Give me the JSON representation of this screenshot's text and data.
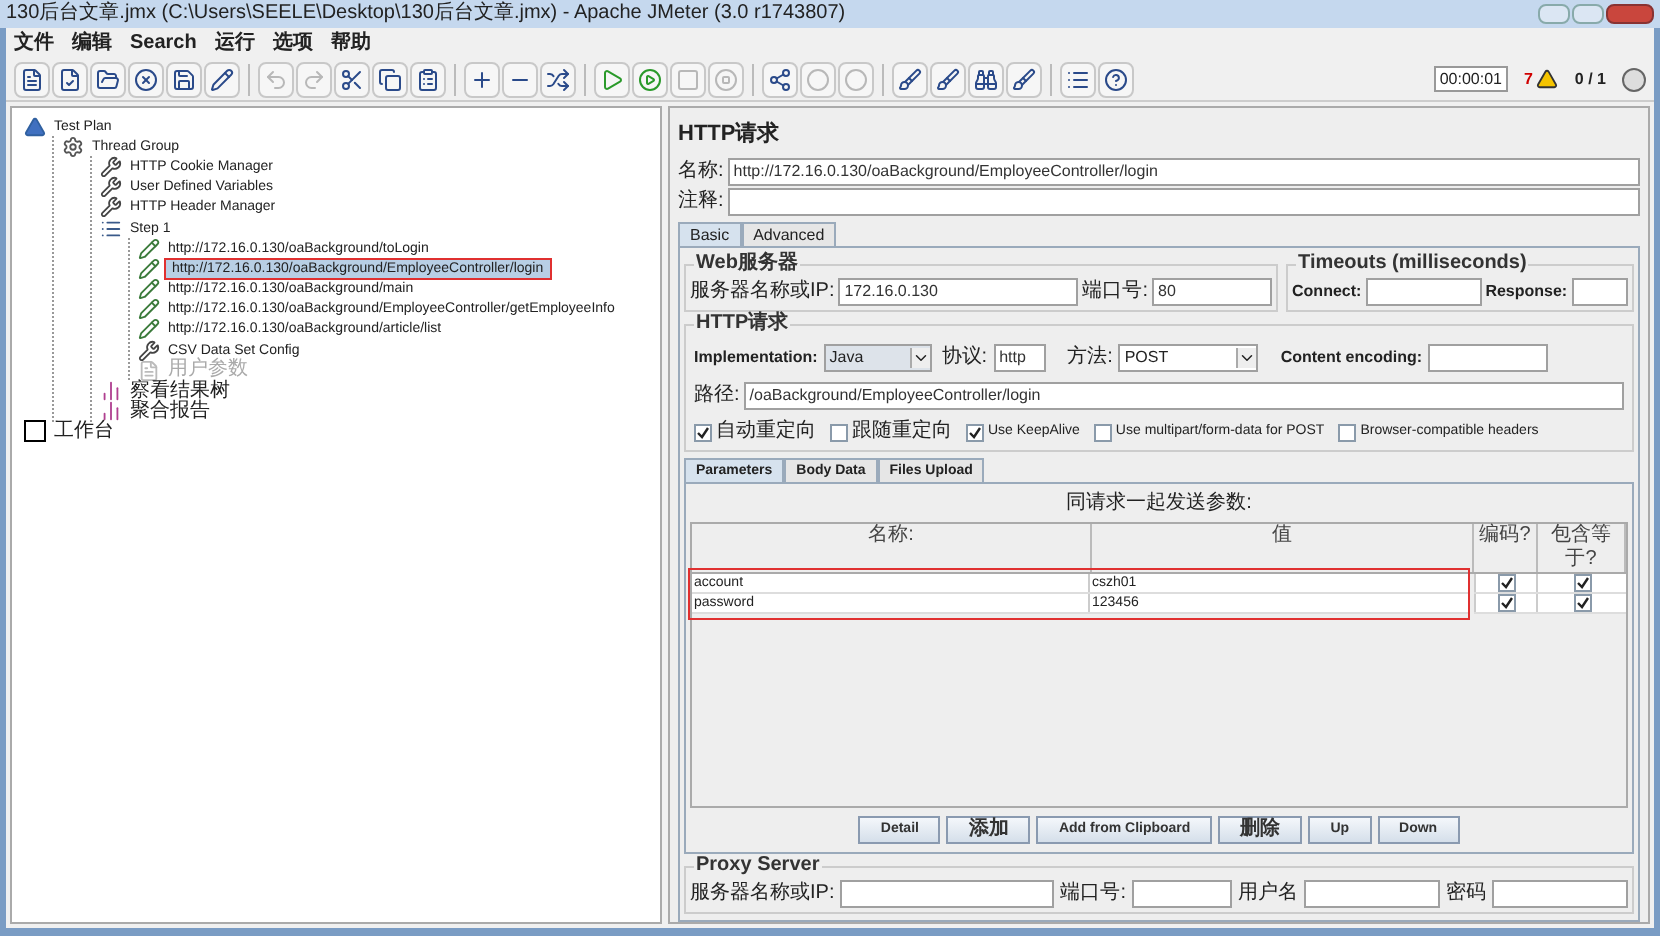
{
  "window": {
    "title": "130后台文章.jmx (C:\\Users\\SEELE\\Desktop\\130后台文章.jmx) - Apache JMeter (3.0 r1743807)"
  },
  "menu": [
    "文件",
    "编辑",
    "Search",
    "运行",
    "选项",
    "帮助"
  ],
  "toolbar": [
    {
      "disabled": false
    },
    {
      "disabled": false
    },
    {
      "disabled": false
    },
    {
      "disabled": false
    },
    {
      "disabled": false
    },
    {
      "disabled": false
    },
    {
      "disabled": true
    },
    {
      "disabled": true
    },
    {
      "disabled": false
    },
    {
      "disabled": false
    },
    {
      "disabled": false
    },
    {
      "disabled": false
    },
    {
      "disabled": false
    },
    {
      "disabled": false
    },
    {
      "disabled": false
    },
    {
      "disabled": false
    },
    {
      "disabled": true
    },
    {
      "disabled": true
    },
    {
      "disabled": false
    },
    {
      "disabled": true
    },
    {
      "disabled": true
    },
    {
      "disabled": false
    },
    {
      "disabled": false
    },
    {
      "disabled": false
    },
    {
      "disabled": false
    },
    {
      "disabled": false
    },
    {
      "disabled": false
    }
  ],
  "status": {
    "timer": "00:00:01",
    "warnings": "7",
    "threads": "0 / 1"
  },
  "tree": [
    {
      "label": "Test Plan",
      "kind": "plan",
      "selected": false,
      "disabled": false,
      "children": [
        {
          "label": "Thread Group",
          "kind": "threads",
          "selected": false,
          "disabled": false,
          "children": [
            {
              "label": "HTTP Cookie Manager",
              "kind": "config",
              "selected": false,
              "disabled": false
            },
            {
              "label": "User Defined Variables",
              "kind": "config",
              "selected": false,
              "disabled": false
            },
            {
              "label": "HTTP Header Manager",
              "kind": "config",
              "selected": false,
              "disabled": false
            },
            {
              "label": "Step 1",
              "kind": "controller",
              "selected": false,
              "disabled": false,
              "children": [
                {
                  "label": "http://172.16.0.130/oaBackground/toLogin",
                  "kind": "sampler",
                  "selected": false,
                  "disabled": false
                },
                {
                  "label": "http://172.16.0.130/oaBackground/EmployeeController/login",
                  "kind": "sampler",
                  "selected": true,
                  "disabled": false
                },
                {
                  "label": "http://172.16.0.130/oaBackground/main",
                  "kind": "sampler",
                  "selected": false,
                  "disabled": false
                },
                {
                  "label": "http://172.16.0.130/oaBackground/EmployeeController/getEmployeeInfo",
                  "kind": "sampler",
                  "selected": false,
                  "disabled": false
                },
                {
                  "label": "http://172.16.0.130/oaBackground/article/list",
                  "kind": "sampler",
                  "selected": false,
                  "disabled": false
                },
                {
                  "label": "CSV Data Set Config",
                  "kind": "config",
                  "selected": false,
                  "disabled": false
                },
                {
                  "label": "用户参数",
                  "kind": "preprocessor",
                  "selected": false,
                  "disabled": true
                }
              ]
            },
            {
              "label": "察看结果树",
              "kind": "listener",
              "selected": false,
              "disabled": false
            },
            {
              "label": "聚合报告",
              "kind": "listener",
              "selected": false,
              "disabled": false
            }
          ]
        }
      ]
    },
    {
      "label": "工作台",
      "kind": "workbench",
      "selected": false,
      "disabled": false
    }
  ],
  "panel": {
    "title": "HTTP请求",
    "name_label": "名称:",
    "name": "http://172.16.0.130/oaBackground/EmployeeController/login",
    "comment_label": "注释:",
    "tabs": [
      {
        "label": "Basic",
        "selected": true
      },
      {
        "label": "Advanced",
        "selected": false
      }
    ],
    "web_server": {
      "legend": "Web服务器",
      "host_label": "服务器名称或IP:",
      "host": "172.16.0.130",
      "port_label": "端口号:",
      "port": "80"
    },
    "timeouts": {
      "legend": "Timeouts (milliseconds)",
      "connect_label": "Connect:",
      "response_label": "Response:"
    },
    "http_request": {
      "legend": "HTTP请求",
      "implementation_label": "Implementation:",
      "implementation": "Java",
      "protocol_label": "协议:",
      "protocol": "http",
      "method_label": "方法:",
      "method": "POST",
      "encoding_label": "Content encoding:",
      "path_label": "路径:",
      "path": "/oaBackground/EmployeeController/login",
      "options": [
        {
          "label": "自动重定向",
          "checked": true
        },
        {
          "label": "跟随重定向",
          "checked": false
        },
        {
          "label": "Use KeepAlive",
          "checked": true
        },
        {
          "label": "Use multipart/form-data for POST",
          "checked": false
        },
        {
          "label": "Browser-compatible headers",
          "checked": false
        }
      ]
    },
    "param_tabs": [
      {
        "label": "Parameters",
        "selected": true
      },
      {
        "label": "Body Data",
        "selected": false
      },
      {
        "label": "Files Upload",
        "selected": false
      }
    ],
    "params": {
      "caption": "同请求一起发送参数:",
      "columns": [
        "名称:",
        "值",
        "编码?",
        "包含等于?"
      ],
      "rows": [
        {
          "name": "account",
          "value": "cszh01",
          "encode": true,
          "include_equals": true
        },
        {
          "name": "password",
          "value": "123456",
          "encode": true,
          "include_equals": true
        }
      ]
    },
    "buttons": [
      "Detail",
      "添加",
      "Add from Clipboard",
      "删除",
      "Up",
      "Down"
    ],
    "proxy": {
      "legend": "Proxy Server",
      "host_label": "服务器名称或IP:",
      "port_label": "端口号:",
      "user_label": "用户名",
      "password_label": "密码"
    }
  }
}
